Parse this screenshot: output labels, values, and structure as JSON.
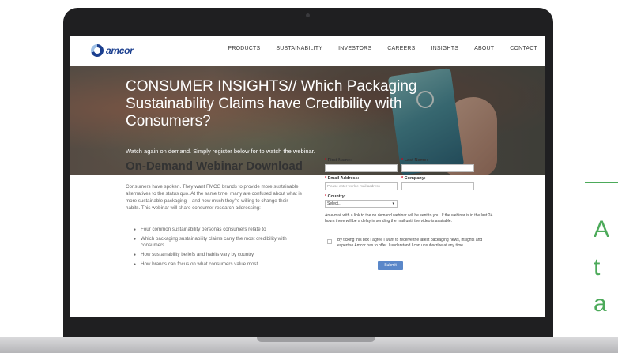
{
  "navbar": {
    "logo_text": "amcor",
    "items": [
      "PRODUCTS",
      "SUSTAINABILITY",
      "INVESTORS",
      "CAREERS",
      "INSIGHTS",
      "ABOUT",
      "CONTACT"
    ]
  },
  "hero": {
    "title": "CONSUMER INSIGHTS// Which Packaging Sustainability Claims have Credibility with Consumers?",
    "subtitle": "Watch again on demand. Simply register below for to watch the webinar."
  },
  "content": {
    "title": "On-Demand Webinar Download",
    "body": "Consumers have spoken. They want FMCG brands to provide more sustainable alternatives to the status quo. At the same time, many are confused about what is more sustainable packaging – and how much they're willing to change their habits. This webinar will share consumer research addressing:",
    "bullets": [
      "Four common sustainability personas consumers relate to",
      "Which packaging sustainability claims carry the most credibility with consumers",
      "How sustainability beliefs and habits vary by country",
      "How brands can focus on what consumers value most"
    ]
  },
  "form": {
    "first_name_label": "First Name:",
    "last_name_label": "Last Name:",
    "email_label": "Email Address:",
    "email_placeholder": "Please enter work e-mail address",
    "company_label": "Company:",
    "country_label": "Country:",
    "country_value": "Select...",
    "note": "An e-mail with a link to the on demand webinar will be sent to you. If the webinar is in the last 24 hours there will be a delay in sending the mail until the video is available.",
    "consent": "By ticking this box I agree I want to receive the latest packaging news, insights and expertise Amcor has to offer. I understand I can unsubscribe at any time.",
    "submit_label": "Submit",
    "required_mark": "*"
  },
  "slide_right": {
    "letters": [
      "A",
      "t",
      "a"
    ]
  },
  "colors": {
    "brand_blue": "#1b3f8f",
    "submit_blue": "#5a87c9",
    "accent_green": "#4caa5a",
    "required_red": "#d0021b"
  }
}
